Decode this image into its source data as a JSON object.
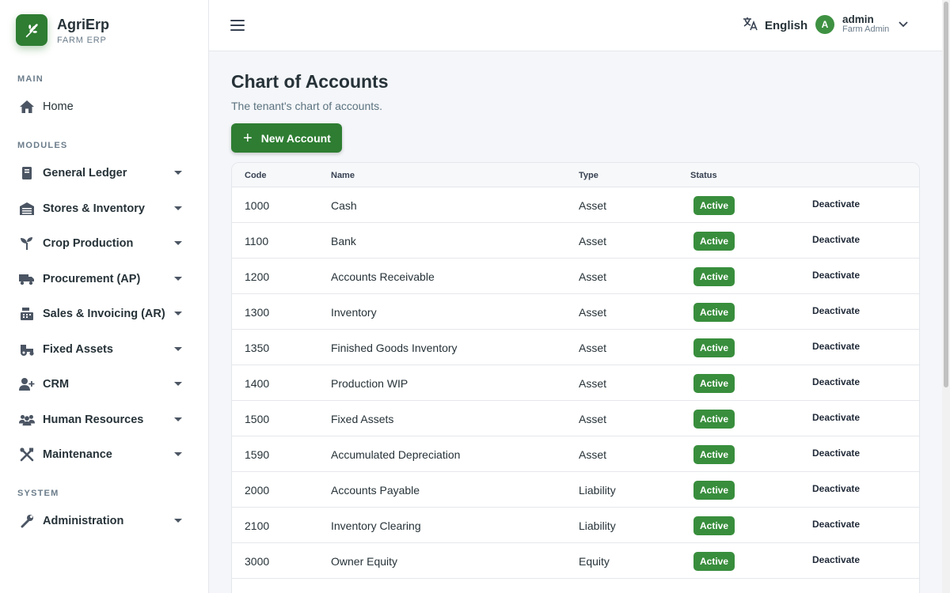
{
  "brand": {
    "name": "AgriErp",
    "subtitle": "FARM ERP"
  },
  "sidebar": {
    "section_main": "MAIN",
    "section_modules": "MODULES",
    "section_system": "SYSTEM",
    "home": "Home",
    "modules": [
      {
        "label": "General Ledger",
        "icon": "book-icon"
      },
      {
        "label": "Stores & Inventory",
        "icon": "warehouse-icon"
      },
      {
        "label": "Crop Production",
        "icon": "sprout-icon"
      },
      {
        "label": "Procurement (AP)",
        "icon": "truck-icon"
      },
      {
        "label": "Sales & Invoicing (AR)",
        "icon": "cash-register-icon"
      },
      {
        "label": "Fixed Assets",
        "icon": "tractor-icon"
      },
      {
        "label": "CRM",
        "icon": "user-plus-icon"
      },
      {
        "label": "Human Resources",
        "icon": "people-icon"
      },
      {
        "label": "Maintenance",
        "icon": "tools-icon"
      }
    ],
    "system": [
      {
        "label": "Administration",
        "icon": "wrench-icon"
      }
    ]
  },
  "header": {
    "language": "English",
    "user": {
      "initial": "A",
      "name": "admin",
      "role": "Farm Admin"
    }
  },
  "page": {
    "title": "Chart of Accounts",
    "subtitle": "The tenant's chart of accounts.",
    "new_button": "New Account"
  },
  "table": {
    "headers": [
      "Code",
      "Name",
      "Type",
      "Status"
    ],
    "rows": [
      {
        "code": "1000",
        "name": "Cash",
        "type": "Asset",
        "status": "Active",
        "action": "Deactivate"
      },
      {
        "code": "1100",
        "name": "Bank",
        "type": "Asset",
        "status": "Active",
        "action": "Deactivate"
      },
      {
        "code": "1200",
        "name": "Accounts Receivable",
        "type": "Asset",
        "status": "Active",
        "action": "Deactivate"
      },
      {
        "code": "1300",
        "name": "Inventory",
        "type": "Asset",
        "status": "Active",
        "action": "Deactivate"
      },
      {
        "code": "1350",
        "name": "Finished Goods Inventory",
        "type": "Asset",
        "status": "Active",
        "action": "Deactivate"
      },
      {
        "code": "1400",
        "name": "Production WIP",
        "type": "Asset",
        "status": "Active",
        "action": "Deactivate"
      },
      {
        "code": "1500",
        "name": "Fixed Assets",
        "type": "Asset",
        "status": "Active",
        "action": "Deactivate"
      },
      {
        "code": "1590",
        "name": "Accumulated Depreciation",
        "type": "Asset",
        "status": "Active",
        "action": "Deactivate"
      },
      {
        "code": "2000",
        "name": "Accounts Payable",
        "type": "Liability",
        "status": "Active",
        "action": "Deactivate"
      },
      {
        "code": "2100",
        "name": "Inventory Clearing",
        "type": "Liability",
        "status": "Active",
        "action": "Deactivate"
      },
      {
        "code": "3000",
        "name": "Owner Equity",
        "type": "Equity",
        "status": "Active",
        "action": "Deactivate"
      }
    ]
  },
  "colors": {
    "primary": "#2e7d32",
    "badge": "#388e3c",
    "text": "#263238"
  }
}
